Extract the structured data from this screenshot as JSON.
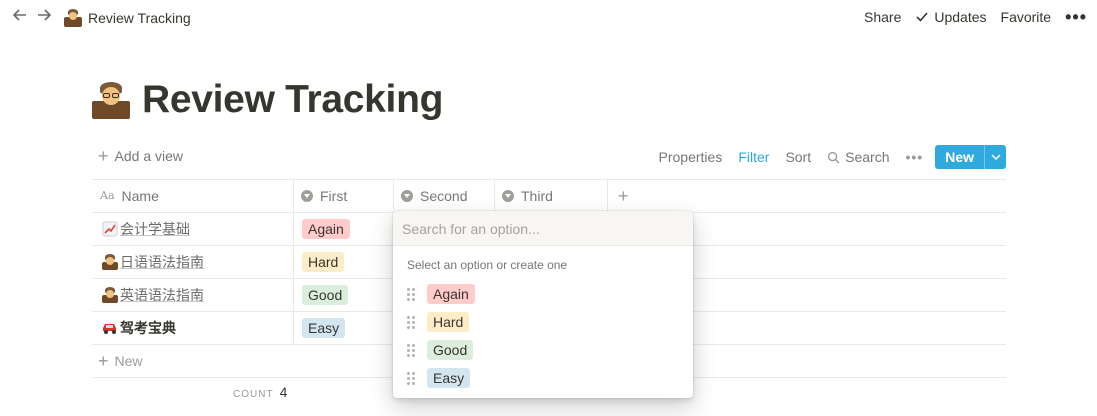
{
  "topbar": {
    "back_icon": "arrow-left-icon",
    "forward_icon": "arrow-right-icon",
    "breadcrumb": "Review Tracking",
    "share": "Share",
    "updates": "Updates",
    "favorite": "Favorite",
    "more": "•••"
  },
  "page": {
    "title": "Review Tracking",
    "icon": "teacher-emoji"
  },
  "toolbar": {
    "add_view": "Add a view",
    "properties": "Properties",
    "filter": "Filter",
    "sort": "Sort",
    "search": "Search",
    "more": "•••",
    "new": "New"
  },
  "table": {
    "columns": [
      {
        "label": "Name",
        "icon": "text-type-icon"
      },
      {
        "label": "First",
        "icon": "select-icon"
      },
      {
        "label": "Second",
        "icon": "select-icon"
      },
      {
        "label": "Third",
        "icon": "select-icon"
      }
    ],
    "rows": [
      {
        "emoji": "chart-increasing-emoji",
        "name": "会计学基础",
        "first": "Again",
        "first_color": "#ffcbcb",
        "bold": false
      },
      {
        "emoji": "teacher-emoji",
        "name": "日语语法指南",
        "first": "Hard",
        "first_color": "#fdecc8",
        "bold": false
      },
      {
        "emoji": "teacher-emoji",
        "name": "英语语法指南",
        "first": "Good",
        "first_color": "#dbeddb",
        "bold": false
      },
      {
        "emoji": "car-emoji",
        "name": "驾考宝典",
        "first": "Easy",
        "first_color": "#d3e5ef",
        "bold": true
      }
    ],
    "new_row": "New",
    "count_label": "COUNT",
    "count_value": "4"
  },
  "dropdown": {
    "search_placeholder": "Search for an option...",
    "hint": "Select an option or create one",
    "options": [
      {
        "label": "Again",
        "color": "#ffcbcb"
      },
      {
        "label": "Hard",
        "color": "#fdecc8"
      },
      {
        "label": "Good",
        "color": "#dbeddb"
      },
      {
        "label": "Easy",
        "color": "#d3e5ef"
      }
    ]
  },
  "colors": {
    "accent": "#2eaadc",
    "text": "#37352f",
    "muted": "#787774",
    "border": "#e9e9e7"
  }
}
